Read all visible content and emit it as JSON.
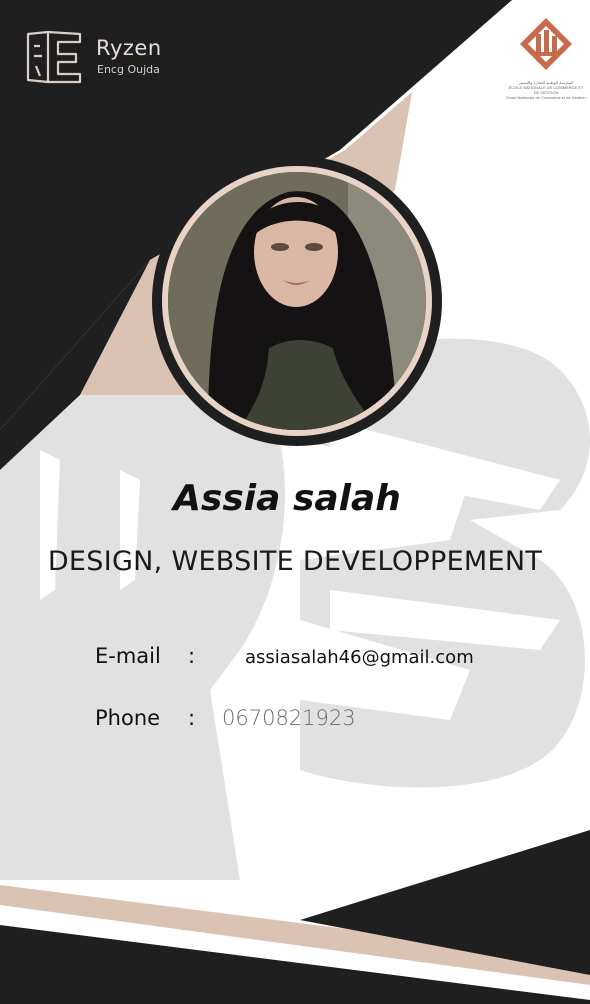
{
  "brand": {
    "name": "Ryzen",
    "subtitle": "Encg Oujda",
    "logo_letters": "RE"
  },
  "school": {
    "arabic_text": "المدرسة الوطنية للتجارة والتسيير",
    "text_line1": "ÉCOLE NATIONALE DE COMMERCE ET DE GESTION",
    "text_line2": "Ecole Nationale de Commerce et de Gestion"
  },
  "profile": {
    "name": "Assia salah",
    "role": "DESIGN, WEBSITE DEVELOPPEMENT"
  },
  "contact": {
    "email_label": "E-mail",
    "email_sep": ":",
    "email_value": "assiasalah46@gmail.com",
    "phone_label": "Phone",
    "phone_sep": ":",
    "phone_value": "0670821923"
  },
  "colors": {
    "dark": "#1f1f1f",
    "beige": "#dbc3b3",
    "watermark": "#e2e2e2",
    "school_logo": "#c86a4c"
  }
}
